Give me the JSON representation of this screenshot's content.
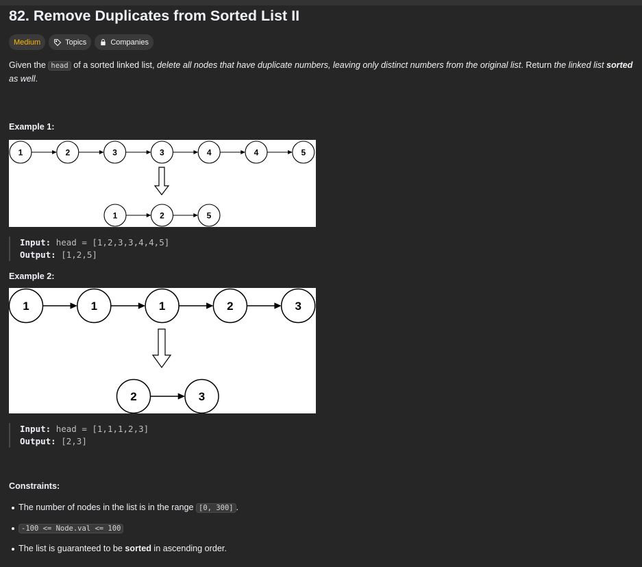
{
  "problem": {
    "title": "82. Remove Duplicates from Sorted List II",
    "tags": {
      "difficulty": "Medium",
      "topics": "Topics",
      "companies": "Companies"
    },
    "description": {
      "p1": "Given the ",
      "code_head": "head",
      "p2": " of a sorted linked list, ",
      "italic1": "delete all nodes that have duplicate numbers, leaving only distinct numbers from the original list",
      "p3": ". Return ",
      "italic2": "the linked list ",
      "bold_sorted": "sorted",
      "italic3": " as well",
      "p4": "."
    }
  },
  "examples": [
    {
      "title": "Example 1:",
      "input_label": "Input:",
      "input_value": "head = [1,2,3,3,4,4,5]",
      "output_label": "Output:",
      "output_value": "[1,2,5]",
      "before": [
        "1",
        "2",
        "3",
        "3",
        "4",
        "4",
        "5"
      ],
      "after": [
        "1",
        "2",
        "5"
      ]
    },
    {
      "title": "Example 2:",
      "input_label": "Input:",
      "input_value": "head = [1,1,1,2,3]",
      "output_label": "Output:",
      "output_value": "[2,3]",
      "before": [
        "1",
        "1",
        "1",
        "2",
        "3"
      ],
      "after": [
        "2",
        "3"
      ]
    }
  ],
  "constraints": {
    "title": "Constraints:",
    "c1_text": "The number of nodes in the list is in the range ",
    "c1_code": "[0, 300]",
    "c1_end": ".",
    "c2_code": "-100 <= Node.val <= 100",
    "c3_pre": "The list is guaranteed to be ",
    "c3_bold": "sorted",
    "c3_post": " in ascending order."
  },
  "colors": {
    "background": "#262626",
    "text": "#eff1f6",
    "difficulty_medium": "#ffb800",
    "figure_background": "#ffffff"
  }
}
